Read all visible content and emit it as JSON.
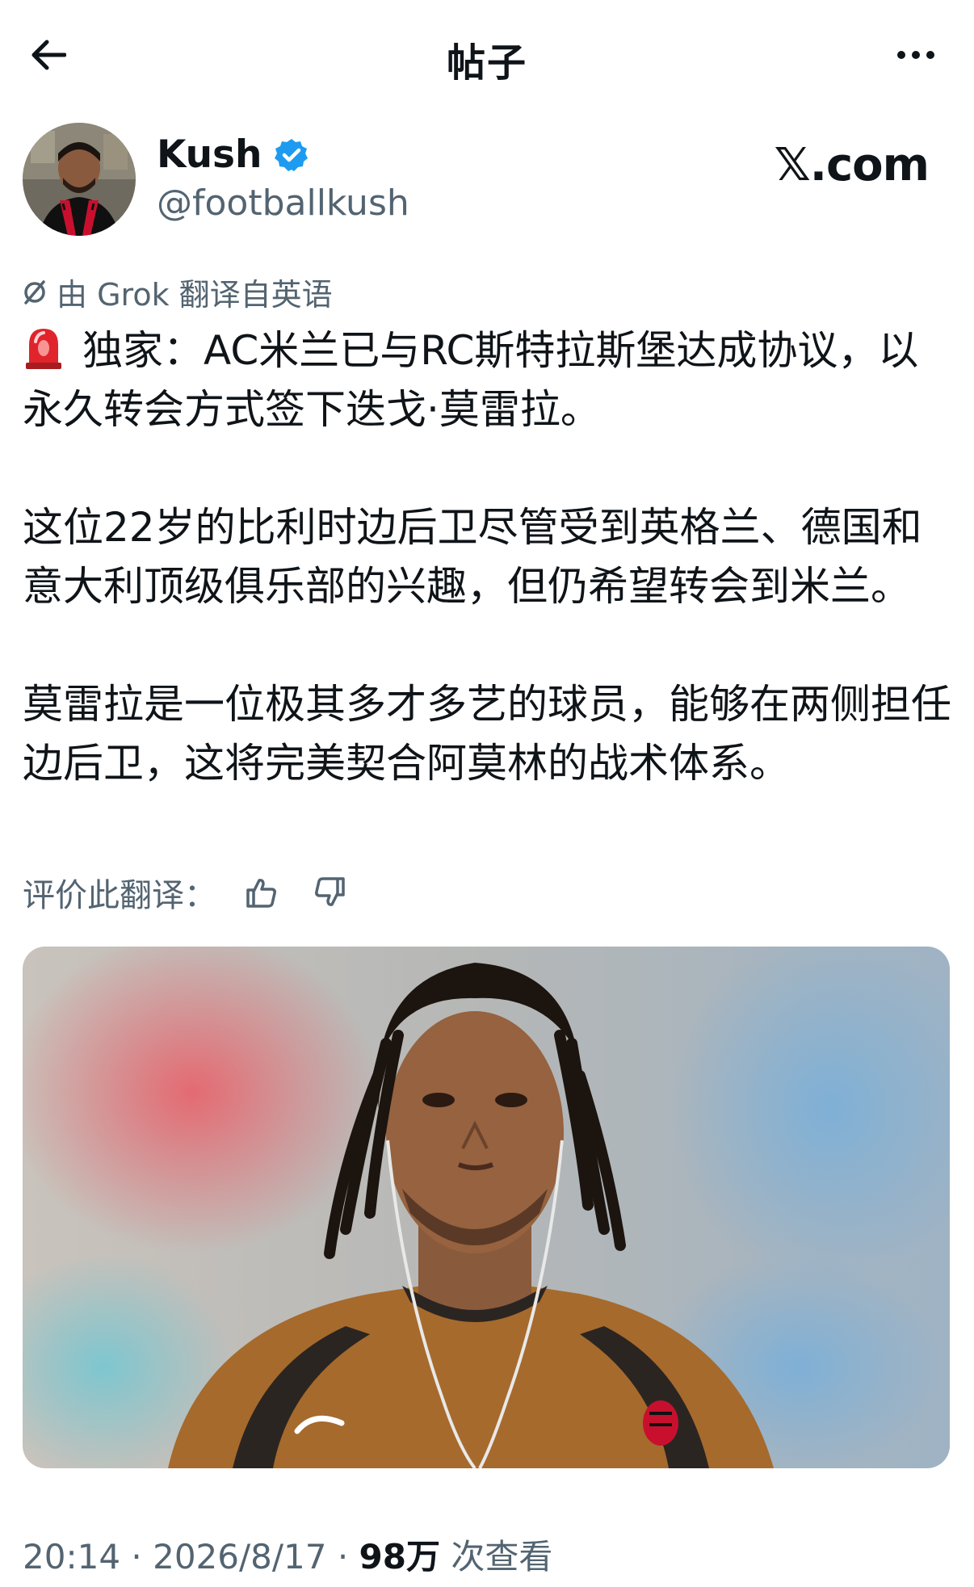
{
  "header": {
    "title": "帖子"
  },
  "author": {
    "name": "Kush",
    "handle": "@footballkush",
    "verified": true
  },
  "source_logo": "𝕏.com",
  "translation_note": "由 Grok 翻译自英语",
  "post": {
    "paragraph1": "独家：AC米兰已与RC斯特拉斯堡达成协议，以永久转会方式签下迭戈·莫雷拉。",
    "paragraph2": "这位22岁的比利时边后卫尽管受到英格兰、德国和意大利顶级俱乐部的兴趣，但仍希望转会到米兰。",
    "paragraph3": "莫雷拉是一位极其多才多艺的球员，能够在两侧担任边后卫，这将完美契合阿莫林的战术体系。"
  },
  "rate_translation_label": "评价此翻译：",
  "meta": {
    "time": "20:14",
    "separator": " · ",
    "date": "2026/8/17",
    "views_count": "98万",
    "views_label": "次查看"
  },
  "colors": {
    "text": "#0f1419",
    "secondary": "#536471",
    "verified": "#1d9bf0",
    "siren": "#e0242b"
  }
}
